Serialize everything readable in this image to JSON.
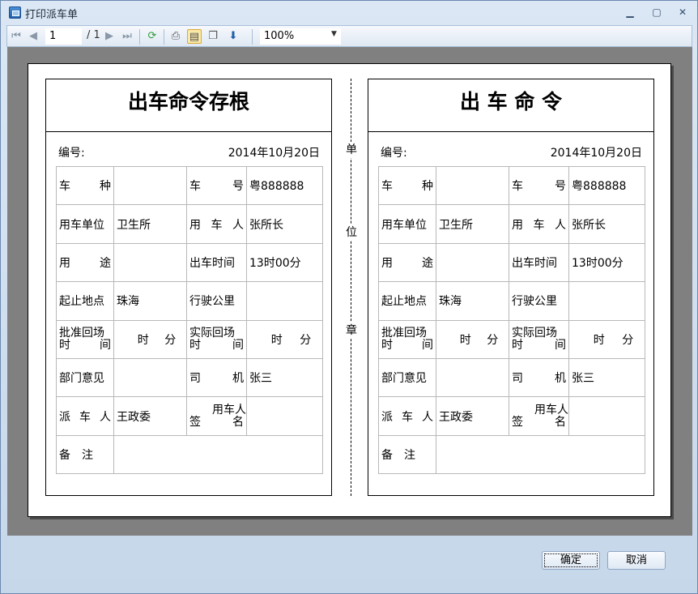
{
  "window": {
    "title": "打印派车单",
    "controls": {
      "minimize": "▁",
      "maximize": "▢",
      "close": "✕"
    }
  },
  "toolbar": {
    "current_page": "1",
    "page_total": "/ 1",
    "zoom": "100%",
    "icons": {
      "first": "first-page-icon",
      "prev": "prev-page-icon",
      "next": "next-page-icon",
      "last": "last-page-icon",
      "refresh": "refresh-icon",
      "print": "print-icon",
      "layout": "page-layout-icon",
      "page_setup": "page-setup-icon",
      "export": "export-icon"
    }
  },
  "stub": {
    "title": "出车命令存根",
    "number_label": "编号:",
    "date": "2014年10月20日"
  },
  "order": {
    "title": "出 车 命 令",
    "number_label": "编号:",
    "date": "2014年10月20日"
  },
  "fields": {
    "vehicle_type": [
      "车",
      "种"
    ],
    "vehicle_no": [
      "车",
      "号"
    ],
    "vehicle_no_value": "粤888888",
    "unit": "用车单位",
    "unit_value": "卫生所",
    "user": [
      "用",
      "车",
      "人"
    ],
    "user_value": "张所长",
    "purpose": [
      "用",
      "途"
    ],
    "depart_time": "出车时间",
    "depart_time_value": "13时00分",
    "route": "起止地点",
    "route_value": "珠海",
    "mileage": "行驶公里",
    "approved_return_l1": "批准回场",
    "approved_return_l2": [
      "时",
      "间"
    ],
    "actual_return_l1": "实际回场",
    "actual_return_l2": [
      "时",
      "间"
    ],
    "hour": "时",
    "minute": "分",
    "dept_opinion": "部门意见",
    "driver": [
      "司",
      "机"
    ],
    "driver_value": "张三",
    "dispatcher": [
      "派",
      "车",
      "人"
    ],
    "dispatcher_value": "王政委",
    "user_sign_l1": [
      "用",
      "车",
      "人"
    ],
    "user_sign_l2": [
      "签",
      "名"
    ],
    "remarks": [
      "备",
      "注"
    ]
  },
  "seal": [
    "单",
    "位",
    "章"
  ],
  "buttons": {
    "ok": "确定",
    "cancel": "取消"
  }
}
